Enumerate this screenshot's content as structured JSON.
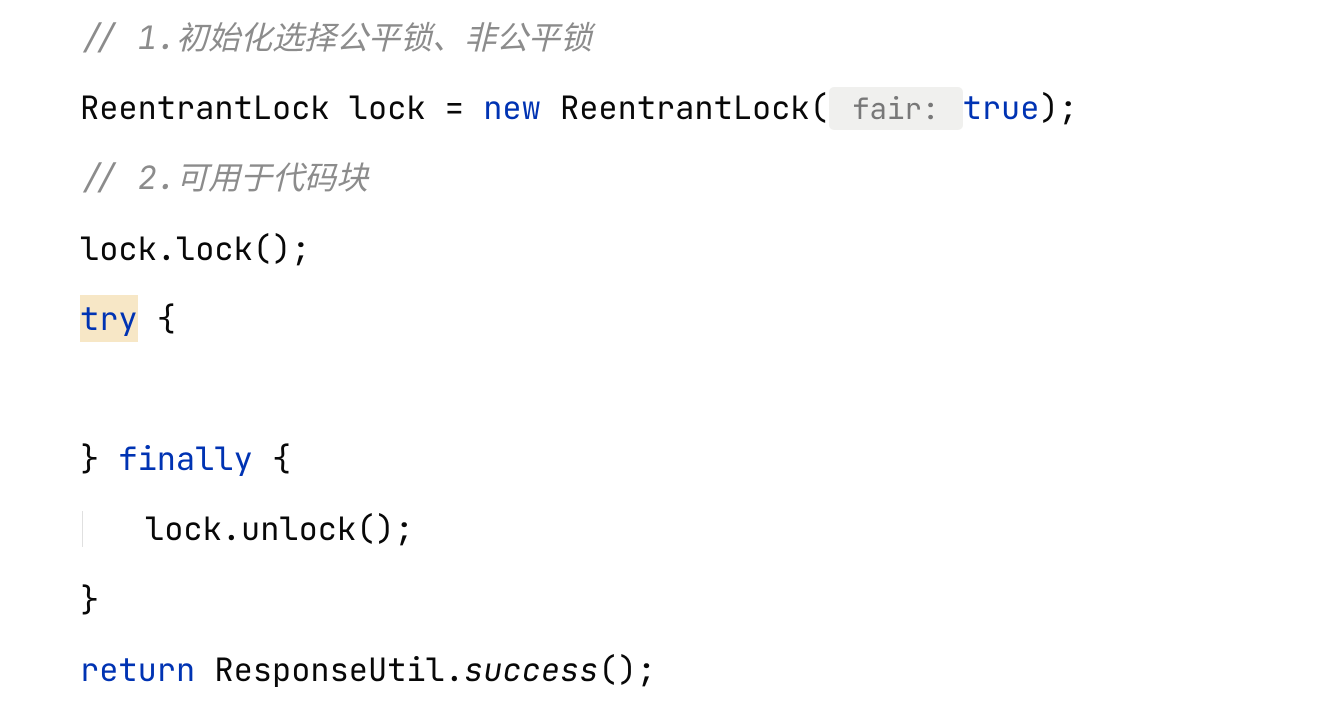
{
  "code": {
    "line1_comment": "// 1.初始化选择公平锁、非公平锁",
    "line2_type": "ReentrantLock",
    "line2_var": " lock = ",
    "line2_new": "new",
    "line2_ctor": " ReentrantLock(",
    "line2_paramhint": " fair: ",
    "line2_true": "true",
    "line2_close": ");",
    "line3_comment": "// 2.可用于代码块",
    "line4": "lock.lock();",
    "line5_try": "try",
    "line5_brace": " {",
    "line6_empty": "",
    "line7_close": "} ",
    "line7_finally": "finally",
    "line7_brace": " {",
    "line8_unlock": "lock.unlock();",
    "line9_close": "}",
    "line10_return": "return",
    "line10_class": " ResponseUtil.",
    "line10_method": "success",
    "line10_paren": "();"
  }
}
